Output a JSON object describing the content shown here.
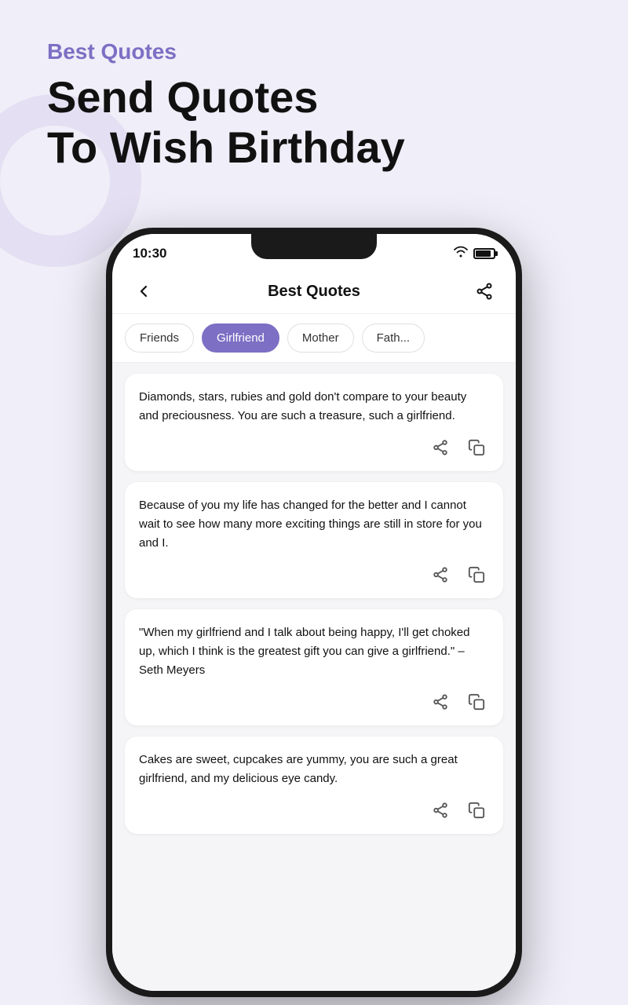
{
  "page": {
    "bg_label": "Best Quotes",
    "main_title_line1": "Send Quotes",
    "main_title_line2": "To Wish Birthday"
  },
  "status_bar": {
    "time": "10:30",
    "wifi_label": "wifi",
    "battery_label": "battery"
  },
  "app_header": {
    "title": "Best Quotes",
    "back_label": "←",
    "share_label": "share"
  },
  "tabs": [
    {
      "id": "friends",
      "label": "Friends",
      "active": false
    },
    {
      "id": "girlfriend",
      "label": "Girlfriend",
      "active": true
    },
    {
      "id": "mother",
      "label": "Mother",
      "active": false
    },
    {
      "id": "father",
      "label": "Fath...",
      "active": false
    }
  ],
  "quotes": [
    {
      "id": 1,
      "text": "Diamonds, stars, rubies and gold don't compare to your beauty and preciousness. You are such a treasure, such a girlfriend."
    },
    {
      "id": 2,
      "text": "Because of you my life has changed for the better and I cannot wait to see how many more exciting things are still in store for you and I."
    },
    {
      "id": 3,
      "text": "\"When my girlfriend and I talk about being happy, I'll get choked up, which I think is the greatest gift you can give a girlfriend.\" – Seth Meyers"
    },
    {
      "id": 4,
      "text": "Cakes are sweet, cupcakes are yummy, you are such a great girlfriend, and my delicious eye candy."
    }
  ]
}
